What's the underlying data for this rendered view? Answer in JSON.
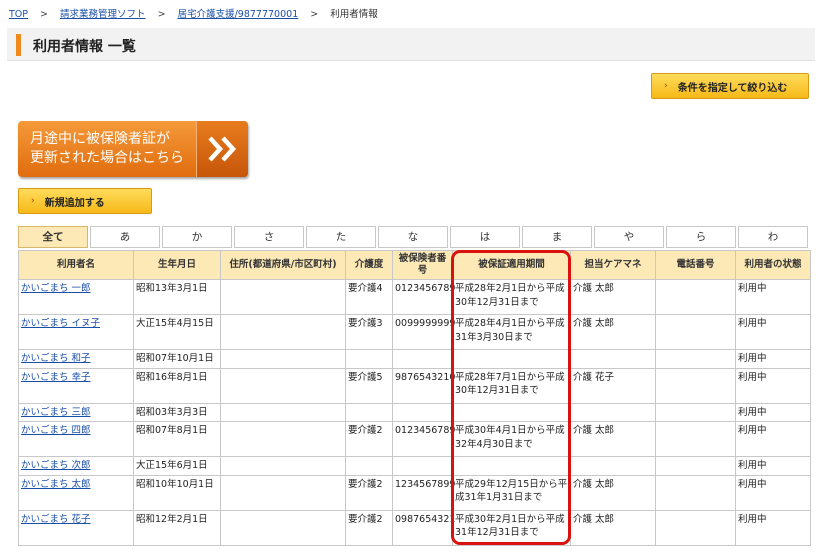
{
  "breadcrumb": {
    "items": [
      "TOP",
      "請求業務管理ソフト",
      "居宅介護支援/9877770001"
    ],
    "current": "利用者情報",
    "separator": ">"
  },
  "page": {
    "title": "利用者情報 一覧"
  },
  "filter_button": {
    "label": "条件を指定して絞り込む"
  },
  "banner": {
    "text": "月途中に被保険者証が\n更新された場合はこちら",
    "icon": "double-chevron-right-icon"
  },
  "add_button": {
    "label": "新規追加する"
  },
  "tabs": [
    "全て",
    "あ",
    "か",
    "さ",
    "た",
    "な",
    "は",
    "ま",
    "や",
    "ら",
    "わ"
  ],
  "active_tab": "全て",
  "table": {
    "headers": [
      "利用者名",
      "生年月日",
      "住所(都道府県/市区町村)",
      "介護度",
      "被保険者番号",
      "被保証適用期間",
      "担当ケアマネ",
      "電話番号",
      "利用者の状態"
    ],
    "rows": [
      {
        "name": "かいごまち 一郎",
        "birth": "昭和13年3月1日",
        "address": "",
        "level": "要介護4",
        "insured_no": "0123456789",
        "period": "平成28年2月1日から平成30年12月31日まで",
        "manager": "介護 太郎",
        "phone": "",
        "status": "利用中"
      },
      {
        "name": "かいごまち イヌ子",
        "birth": "大正15年4月15日",
        "address": "",
        "level": "要介護3",
        "insured_no": "0099999999",
        "period": "平成28年4月1日から平成31年3月30日まで",
        "manager": "介護 太郎",
        "phone": "",
        "status": "利用中"
      },
      {
        "name": "かいごまち 和子",
        "birth": "昭和07年10月1日",
        "address": "",
        "level": "",
        "insured_no": "",
        "period": "",
        "manager": "",
        "phone": "",
        "status": "利用中"
      },
      {
        "name": "かいごまち 幸子",
        "birth": "昭和16年8月1日",
        "address": "",
        "level": "要介護5",
        "insured_no": "9876543210",
        "period": "平成28年7月1日から平成30年12月31日まで",
        "manager": "介護 花子",
        "phone": "",
        "status": "利用中"
      },
      {
        "name": "かいごまち 三郎",
        "birth": "昭和03年3月3日",
        "address": "",
        "level": "",
        "insured_no": "",
        "period": "",
        "manager": "",
        "phone": "",
        "status": "利用中"
      },
      {
        "name": "かいごまち 四郎",
        "birth": "昭和07年8月1日",
        "address": "",
        "level": "要介護2",
        "insured_no": "0123456789",
        "period": "平成30年4月1日から平成32年4月30日まで",
        "manager": "介護 太郎",
        "phone": "",
        "status": "利用中"
      },
      {
        "name": "かいごまち 次郎",
        "birth": "大正15年6月1日",
        "address": "",
        "level": "",
        "insured_no": "",
        "period": "",
        "manager": "",
        "phone": "",
        "status": "利用中"
      },
      {
        "name": "かいごまち 太郎",
        "birth": "昭和10年10月1日",
        "address": "",
        "level": "要介護2",
        "insured_no": "1234567899",
        "period": "平成29年12月15日から平成31年1月31日まで",
        "manager": "介護 太郎",
        "phone": "",
        "status": "利用中"
      },
      {
        "name": "かいごまち 花子",
        "birth": "昭和12年2月1日",
        "address": "",
        "level": "要介護2",
        "insured_no": "0987654321",
        "period": "平成30年2月1日から平成31年12月31日まで",
        "manager": "介護 太郎",
        "phone": "",
        "status": "利用中"
      }
    ]
  },
  "colors": {
    "accent_orange": "#f08a1c",
    "button_yellow": "#f6b918",
    "header_bg": "#fde9b6",
    "highlight_red": "#d9110f",
    "link_blue": "#1a4fa8"
  }
}
